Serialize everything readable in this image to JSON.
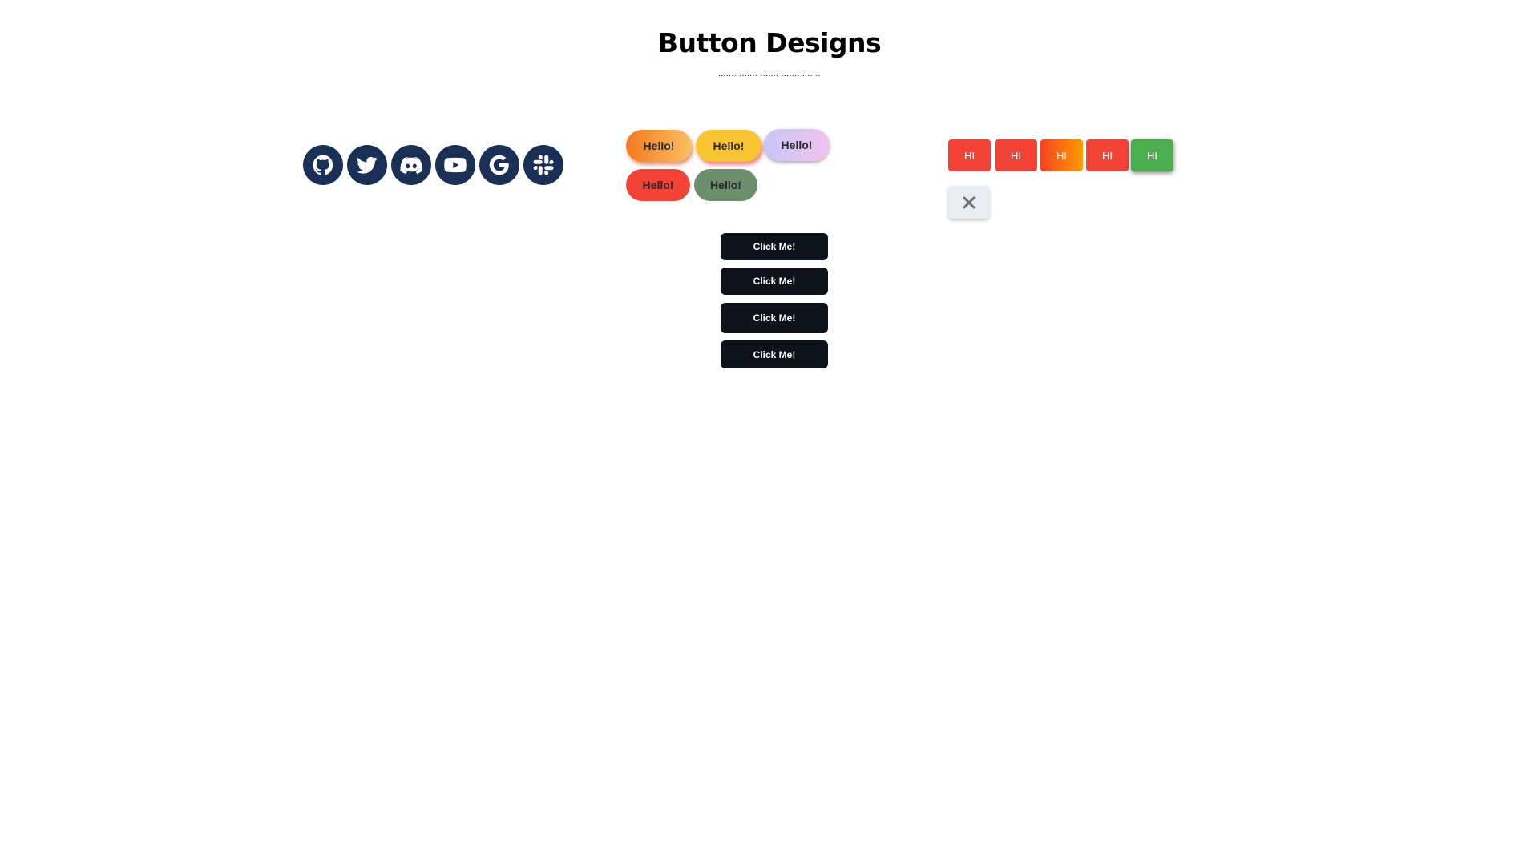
{
  "page": {
    "title": "Button Designs",
    "dots": "....... ....... ....... ....... ......."
  },
  "social": {
    "icons": [
      "github-icon",
      "twitter-icon",
      "discord-icon",
      "youtube-icon",
      "google-icon",
      "slack-icon"
    ],
    "color": "#1a2f55"
  },
  "hello_buttons": {
    "labels": [
      "Hello!",
      "Hello!",
      "Hello!",
      "Hello!",
      "Hello!"
    ]
  },
  "click_buttons": {
    "labels": [
      "Click Me!",
      "Click Me!",
      "Click Me!",
      "Click Me!"
    ]
  },
  "hi_buttons": {
    "labels": [
      "HI",
      "HI",
      "HI",
      "HI",
      "HI"
    ]
  },
  "close_button": {
    "icon": "close-icon"
  },
  "colors": {
    "red": "#f24336",
    "green": "#4aad4e",
    "dark": "#0e131b",
    "navy": "#1a2f55"
  }
}
